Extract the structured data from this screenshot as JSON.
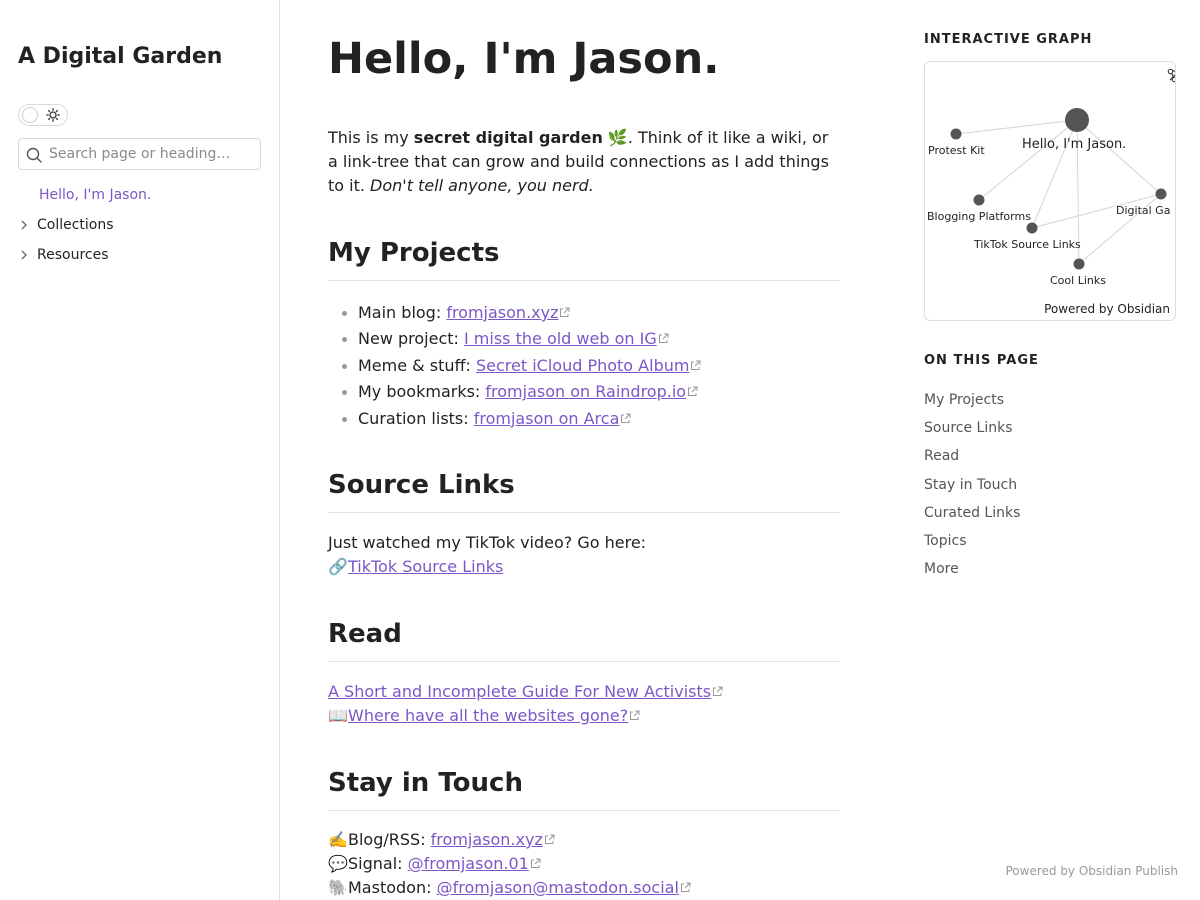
{
  "sidebar": {
    "site_name": "A Digital Garden",
    "search_placeholder": "Search page or heading…",
    "active_item": "Hello, I'm Jason.",
    "folders": [
      "Collections",
      "Resources"
    ]
  },
  "main": {
    "title": "Hello, I'm Jason.",
    "intro": {
      "t1": "This is my ",
      "bold": "secret digital garden",
      "emoji": "🌿",
      "t2": ". Think of it like a wiki, or a link-tree that can grow and build connections as I add things to it. ",
      "italic": "Don't tell anyone, you nerd."
    },
    "projects_heading": "My Projects",
    "projects": [
      {
        "label": "Main blog: ",
        "link": "fromjason.xyz"
      },
      {
        "label": "New project: ",
        "link": "I miss the old web on IG"
      },
      {
        "label": "Meme & stuff: ",
        "link": "Secret iCloud Photo Album"
      },
      {
        "label": "My bookmarks: ",
        "link": "fromjason on Raindrop.io"
      },
      {
        "label": "Curation lists: ",
        "link": "fromjason on Arca"
      }
    ],
    "source_heading": "Source Links",
    "source_text": "Just watched my TikTok video? Go here:",
    "source_emoji": "🔗",
    "source_link": "TikTok Source Links",
    "read_heading": "Read",
    "read_link1": "A Short and Incomplete Guide For New Activists",
    "read_emoji": "📖",
    "read_link2": "Where have all the websites gone?",
    "touch_heading": "Stay in Touch",
    "touch": [
      {
        "emoji": "✍️",
        "label": "Blog/RSS: ",
        "link": "fromjason.xyz"
      },
      {
        "emoji": "💬",
        "label": "Signal: ",
        "link": "@fromjason.01"
      },
      {
        "emoji": "🐘",
        "label": "Mastodon: ",
        "link": "@fromjason@mastodon.social"
      }
    ]
  },
  "right": {
    "graph_heading": "INTERACTIVE GRAPH",
    "graph_nodes": {
      "hello": "Hello, I'm Jason.",
      "protest": "Protest Kit",
      "blogging": "Blogging Platforms",
      "tiktok": "TikTok Source Links",
      "digital": "Digital Ga",
      "cool": "Cool Links"
    },
    "graph_powered": "Powered by Obsidian",
    "toc_heading": "ON THIS PAGE",
    "toc": [
      "My Projects",
      "Source Links",
      "Read",
      "Stay in Touch",
      "Curated Links",
      "Topics",
      "More"
    ]
  },
  "footer": {
    "powered": "Powered by Obsidian Publish"
  },
  "colors": {
    "link": "#7b57c7",
    "text": "#222222",
    "muted": "#999999",
    "border": "#e0e0e0"
  }
}
